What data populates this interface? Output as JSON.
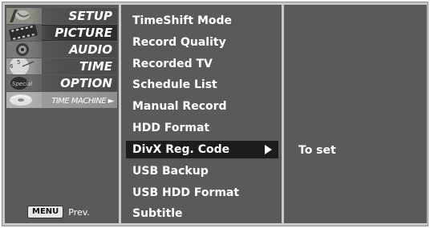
{
  "categories": [
    {
      "label": "SETUP",
      "icon": "satellite-dish-icon"
    },
    {
      "label": "PICTURE",
      "icon": "film-strip-icon"
    },
    {
      "label": "AUDIO",
      "icon": "speaker-icon"
    },
    {
      "label": "TIME",
      "icon": "clock-icon"
    },
    {
      "label": "OPTION",
      "icon": "special-icon"
    },
    {
      "label": "TIME MACHINE ►",
      "icon": "disc-icon"
    }
  ],
  "footer": {
    "menu_key": "MENU",
    "prev_label": "Prev."
  },
  "submenu": {
    "items": [
      {
        "label": "TimeShift Mode"
      },
      {
        "label": "Record Quality"
      },
      {
        "label": "Recorded TV"
      },
      {
        "label": "Schedule List"
      },
      {
        "label": "Manual Record"
      },
      {
        "label": "HDD Format"
      },
      {
        "label": "DivX Reg. Code"
      },
      {
        "label": "USB Backup"
      },
      {
        "label": "USB HDD Format"
      },
      {
        "label": "Subtitle"
      }
    ],
    "selected_index": 6
  },
  "detail": {
    "value": "To set"
  },
  "colors": {
    "panel": "#5a5a5a",
    "frame": "#c9c9c9",
    "selected": "#1c1c1c",
    "active_category": "#9c9c9c"
  }
}
